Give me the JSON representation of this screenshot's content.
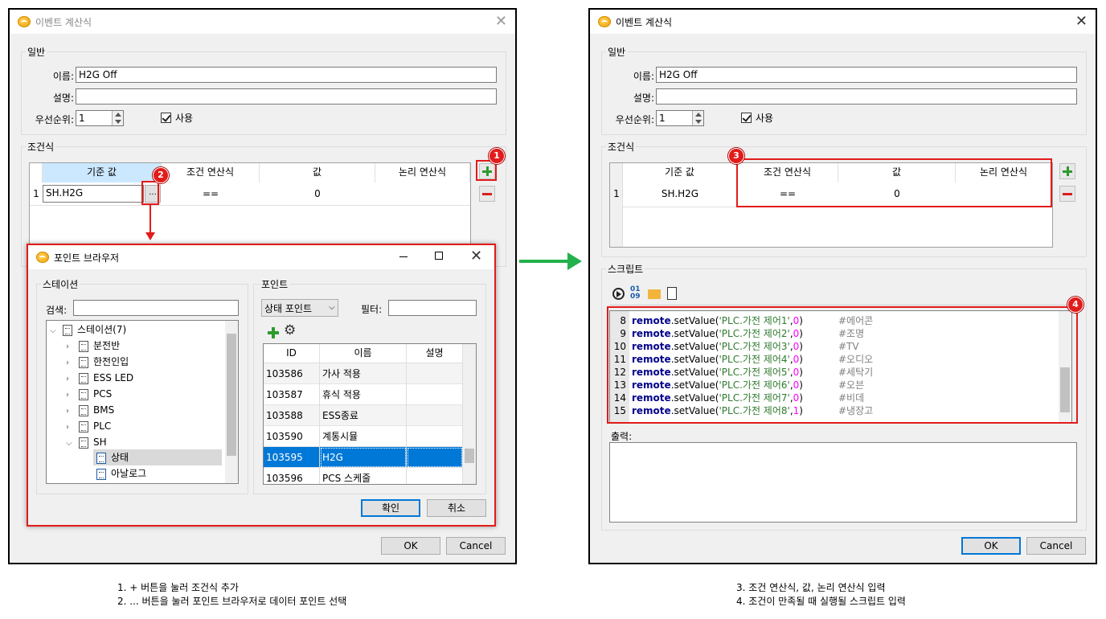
{
  "left_dialog": {
    "title": "이벤트 계산식",
    "general_group": "일반",
    "name_label": "이름:",
    "name_value": "H2G Off",
    "desc_label": "설명:",
    "desc_value": "",
    "priority_label": "우선순위:",
    "priority_value": "1",
    "use_label": "사용",
    "condition_group": "조건식",
    "columns": [
      "기준 값",
      "조건 연산식",
      "값",
      "논리 연산식"
    ],
    "row": {
      "num": "1",
      "base": "SH.H2G",
      "browse": "...",
      "op": "==",
      "value": "0",
      "logic": ""
    },
    "ok": "OK",
    "cancel": "Cancel"
  },
  "point_browser": {
    "title": "포인트 브라우저",
    "station_group": "스테이션",
    "search_label": "검색:",
    "tree": {
      "root": "스테이션(7)",
      "items": [
        "분전반",
        "한전인입",
        "ESS LED",
        "PCS",
        "BMS",
        "PLC",
        "SH"
      ],
      "sh_children": [
        "상태",
        "아날로그"
      ]
    },
    "point_group": "포인트",
    "type_select": "상태 포인트",
    "filter_label": "필터:",
    "filter_value": "",
    "columns": [
      "ID",
      "이름",
      "설명"
    ],
    "rows": [
      {
        "id": "103586",
        "name": "가사 적용",
        "desc": ""
      },
      {
        "id": "103587",
        "name": "휴식 적용",
        "desc": ""
      },
      {
        "id": "103588",
        "name": "ESS종료",
        "desc": ""
      },
      {
        "id": "103590",
        "name": "계통시뮬",
        "desc": ""
      },
      {
        "id": "103595",
        "name": "H2G",
        "desc": ""
      },
      {
        "id": "103596",
        "name": "PCS 스케줄",
        "desc": ""
      }
    ],
    "selected_row": 4,
    "confirm": "확인",
    "cancel": "취소"
  },
  "right_dialog": {
    "title": "이벤트 계산식",
    "general_group": "일반",
    "name_label": "이름:",
    "name_value": "H2G Off",
    "desc_label": "설명:",
    "desc_value": "",
    "priority_label": "우선순위:",
    "priority_value": "1",
    "use_label": "사용",
    "condition_group": "조건식",
    "columns": [
      "기준 값",
      "조건 연산식",
      "값",
      "논리 연산식"
    ],
    "row": {
      "num": "1",
      "base": "SH.H2G",
      "op": "==",
      "value": "0",
      "logic": ""
    },
    "script_group": "스크립트",
    "code_lines": [
      {
        "n": "8",
        "arg": "'PLC.가전 제어1'",
        "val": "0",
        "comment": "#에어콘"
      },
      {
        "n": "9",
        "arg": "'PLC.가전 제어2'",
        "val": "0",
        "comment": "#조명"
      },
      {
        "n": "10",
        "arg": "'PLC.가전 제어3'",
        "val": "0",
        "comment": "#TV"
      },
      {
        "n": "11",
        "arg": "'PLC.가전 제어4'",
        "val": "0",
        "comment": "#오디오"
      },
      {
        "n": "12",
        "arg": "'PLC.가전 제어5'",
        "val": "0",
        "comment": "#세탁기"
      },
      {
        "n": "13",
        "arg": "'PLC.가전 제어6'",
        "val": "0",
        "comment": "#오븐"
      },
      {
        "n": "14",
        "arg": "'PLC.가전 제어7'",
        "val": "0",
        "comment": "#비데"
      },
      {
        "n": "15",
        "arg": "'PLC.가전 제어8'",
        "val": "1",
        "comment": "#냉장고"
      }
    ],
    "code_object": "remote",
    "code_method": ".setValue(",
    "output_label": "출력:",
    "ok": "OK",
    "cancel": "Cancel"
  },
  "badges": [
    "1",
    "2",
    "3",
    "4"
  ],
  "captions": {
    "left_1": "1. + 버튼을 눌러 조건식 추가",
    "left_2": "2. ... 버튼을 눌러 포인트 브라우저로 데이터 포인트 선택",
    "right_1": "3. 조건 연산식, 값, 논리 연산식 입력",
    "right_2": "4. 조건이 만족될 때 실행될 스크립트 입력"
  },
  "colors": {
    "highlight": "#e21b1b",
    "arrow": "#22b14c",
    "selection": "#0078d7",
    "header_blue": "#cce8ff"
  }
}
